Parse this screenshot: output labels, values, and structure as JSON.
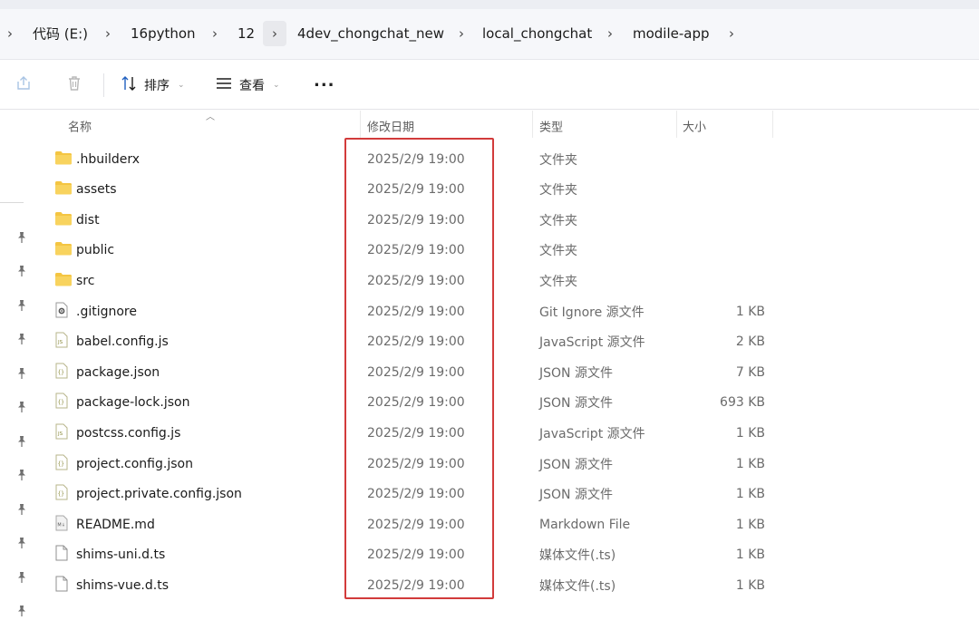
{
  "breadcrumb": {
    "items": [
      "代码 (E:)",
      "16python",
      "12",
      "4dev_chongchat_new",
      "local_chongchat",
      "modile-app"
    ]
  },
  "toolbar": {
    "sort_label": "排序",
    "view_label": "查看",
    "more_label": "···"
  },
  "columns": {
    "name": "名称",
    "modified": "修改日期",
    "type": "类型",
    "size": "大小"
  },
  "files": [
    {
      "name": ".hbuilderx",
      "modified": "2025/2/9 19:00",
      "type": "文件夹",
      "size": "",
      "icon": "folder-icon"
    },
    {
      "name": "assets",
      "modified": "2025/2/9 19:00",
      "type": "文件夹",
      "size": "",
      "icon": "folder-icon"
    },
    {
      "name": "dist",
      "modified": "2025/2/9 19:00",
      "type": "文件夹",
      "size": "",
      "icon": "folder-icon"
    },
    {
      "name": "public",
      "modified": "2025/2/9 19:00",
      "type": "文件夹",
      "size": "",
      "icon": "folder-icon"
    },
    {
      "name": "src",
      "modified": "2025/2/9 19:00",
      "type": "文件夹",
      "size": "",
      "icon": "folder-icon"
    },
    {
      "name": ".gitignore",
      "modified": "2025/2/9 19:00",
      "type": "Git Ignore 源文件",
      "size": "1 KB",
      "icon": "gear-file-icon"
    },
    {
      "name": "babel.config.js",
      "modified": "2025/2/9 19:00",
      "type": "JavaScript 源文件",
      "size": "2 KB",
      "icon": "js-file-icon"
    },
    {
      "name": "package.json",
      "modified": "2025/2/9 19:00",
      "type": "JSON 源文件",
      "size": "7 KB",
      "icon": "json-file-icon"
    },
    {
      "name": "package-lock.json",
      "modified": "2025/2/9 19:00",
      "type": "JSON 源文件",
      "size": "693 KB",
      "icon": "json-file-icon"
    },
    {
      "name": "postcss.config.js",
      "modified": "2025/2/9 19:00",
      "type": "JavaScript 源文件",
      "size": "1 KB",
      "icon": "js-file-icon"
    },
    {
      "name": "project.config.json",
      "modified": "2025/2/9 19:00",
      "type": "JSON 源文件",
      "size": "1 KB",
      "icon": "json-file-icon"
    },
    {
      "name": "project.private.config.json",
      "modified": "2025/2/9 19:00",
      "type": "JSON 源文件",
      "size": "1 KB",
      "icon": "json-file-icon"
    },
    {
      "name": "README.md",
      "modified": "2025/2/9 19:00",
      "type": "Markdown File",
      "size": "1 KB",
      "icon": "markdown-file-icon"
    },
    {
      "name": "shims-uni.d.ts",
      "modified": "2025/2/9 19:00",
      "type": "媒体文件(.ts)",
      "size": "1 KB",
      "icon": "blank-file-icon"
    },
    {
      "name": "shims-vue.d.ts",
      "modified": "2025/2/9 19:00",
      "type": "媒体文件(.ts)",
      "size": "1 KB",
      "icon": "blank-file-icon"
    }
  ],
  "colors": {
    "folder": "#f4c542",
    "highlight": "#d23b3b"
  }
}
